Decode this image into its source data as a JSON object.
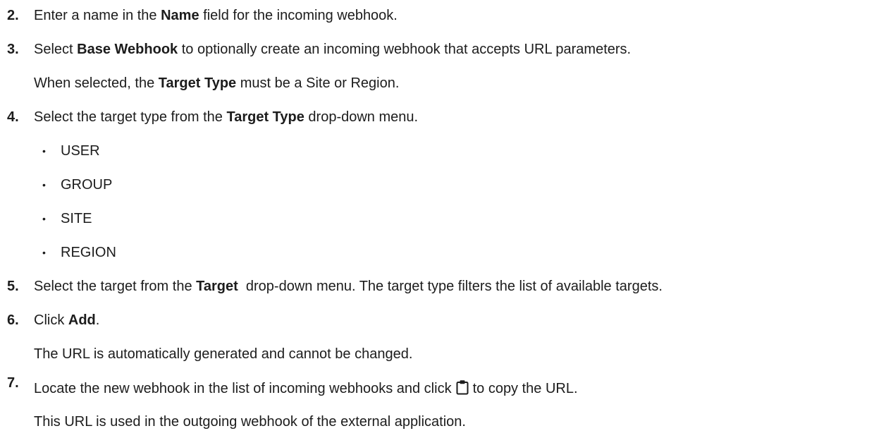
{
  "steps": [
    {
      "number": "2.",
      "before": "Enter a name in the ",
      "bold": "Name",
      "after": " field for the incoming webhook."
    },
    {
      "number": "3.",
      "before": "Select ",
      "bold": "Base Webhook",
      "after": " to optionally create an incoming webhook that accepts URL parameters.",
      "note_before": "When selected, the ",
      "note_bold": "Target Type",
      "note_after": " must be a Site or Region."
    },
    {
      "number": "4.",
      "before": "Select the target type from the ",
      "bold": "Target Type",
      "after": " drop-down menu.",
      "options": [
        "USER",
        "GROUP",
        "SITE",
        "REGION"
      ]
    },
    {
      "number": "5.",
      "before": "Select the target from the ",
      "bold": "Target",
      "after": "  drop-down menu. The target type filters the list of available targets."
    },
    {
      "number": "6.",
      "before": "Click ",
      "bold": "Add",
      "after": ".",
      "note": "The URL is automatically generated and cannot be changed."
    },
    {
      "number": "7.",
      "before": "Locate the new webhook in the list of incoming webhooks and click",
      "icon": "clipboard-icon",
      "after": "to copy the URL.",
      "note": "This URL is used in the outgoing webhook of the external application."
    }
  ],
  "bullet_char": "•"
}
